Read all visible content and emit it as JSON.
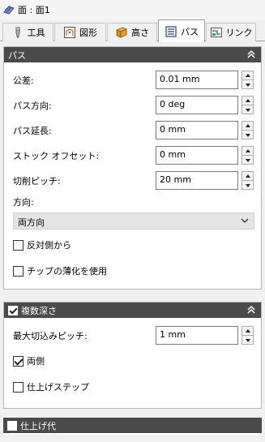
{
  "title": "面 : 面1",
  "tabs": [
    {
      "label": "工具",
      "icon": "tool-icon"
    },
    {
      "label": "図形",
      "icon": "shape-icon"
    },
    {
      "label": "高さ",
      "icon": "height-icon"
    },
    {
      "label": "パス",
      "icon": "path-icon"
    },
    {
      "label": "リンク",
      "icon": "link-icon"
    }
  ],
  "active_tab": "パス",
  "path_panel": {
    "header": "パス",
    "fields": {
      "tolerance": {
        "label": "公差:",
        "value": "0.01 mm"
      },
      "direction_angle": {
        "label": "パス方向:",
        "value": "0 deg"
      },
      "extension": {
        "label": "パス延長:",
        "value": "0 mm"
      },
      "stock_offset": {
        "label": "ストック オフセット:",
        "value": "0 mm"
      },
      "stepover": {
        "label": "切削ピッチ:",
        "value": "20 mm"
      }
    },
    "direction_label": "方向:",
    "direction_value": "両方向",
    "reverse_side": {
      "label": "反対側から",
      "checked": false
    },
    "chip_thinning": {
      "label": "チップの薄化を使用",
      "checked": false
    }
  },
  "multiple_depths_panel": {
    "header": "複数深さ",
    "checked": true,
    "max_stepdown": {
      "label": "最大切込みピッチ:",
      "value": "1 mm"
    },
    "both_sides": {
      "label": "両側",
      "checked": true
    },
    "finishing_step": {
      "label": "仕上げステップ",
      "checked": false
    }
  },
  "finishing_allowance_panel": {
    "header": "仕上げ代",
    "checked": false
  },
  "colors": {
    "panel_header": "#4a4a4a",
    "background": "#f0f0f0",
    "panel_body": "#ffffff"
  }
}
